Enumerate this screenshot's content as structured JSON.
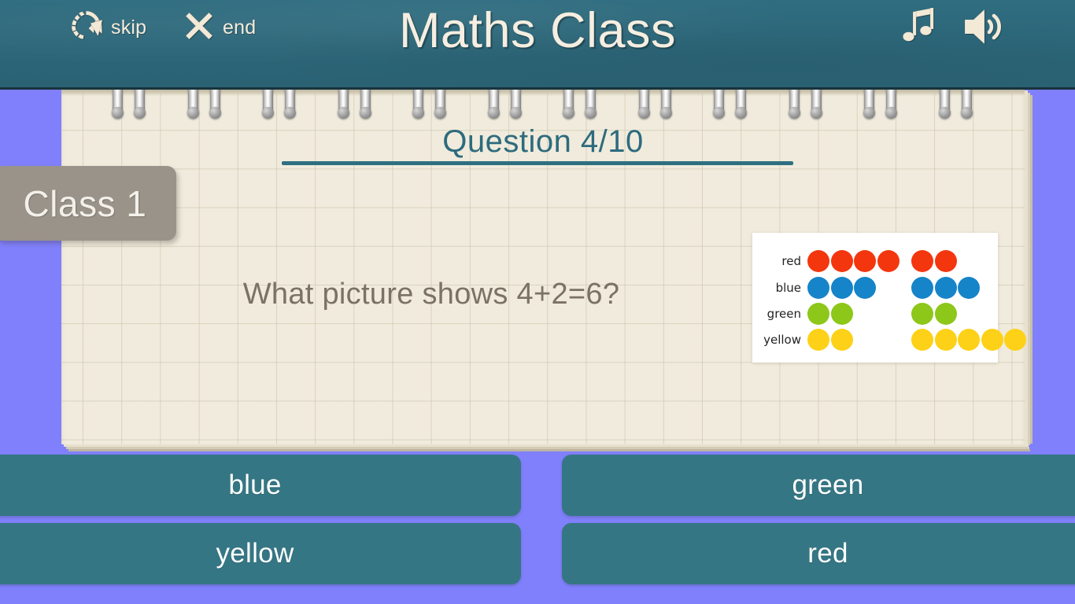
{
  "header": {
    "title": "Maths Class",
    "skip_label": "skip",
    "end_label": "end",
    "skip_icon": "skip-circular-arrow-icon",
    "end_icon": "close-x-icon",
    "music_icon": "music-note-icon",
    "sound_icon": "speaker-volume-icon",
    "background_color": "#2c6678",
    "text_color": "#f6eee0"
  },
  "class_tab": {
    "label": "Class 1",
    "background_color": "#9a938a"
  },
  "page": {
    "question_header": "Question 4/10",
    "question_number": 4,
    "question_total": 10,
    "question_text": "What picture shows 4+2=6?",
    "paper_color": "#f0ebdc",
    "accent_color": "#2d6b7e"
  },
  "chart_data": {
    "type": "table",
    "title": "",
    "xlabel": "",
    "ylabel": "",
    "legend_position": "left",
    "categories": [
      "red",
      "blue",
      "green",
      "yellow"
    ],
    "series": [
      {
        "name": "left group",
        "values": [
          4,
          3,
          2,
          2
        ]
      },
      {
        "name": "right group",
        "values": [
          2,
          3,
          2,
          5
        ]
      }
    ],
    "rows": [
      {
        "label": "red",
        "color": "#f4360e",
        "left_count": 4,
        "right_count": 2,
        "total": 6
      },
      {
        "label": "blue",
        "color": "#1684c8",
        "left_count": 3,
        "right_count": 3,
        "total": 6
      },
      {
        "label": "green",
        "color": "#8dc71a",
        "left_count": 2,
        "right_count": 2,
        "total": 4
      },
      {
        "label": "yellow",
        "color": "#fdd117",
        "left_count": 2,
        "right_count": 5,
        "total": 7
      }
    ]
  },
  "answers": {
    "options": [
      {
        "label": "blue"
      },
      {
        "label": "green"
      },
      {
        "label": "yellow"
      },
      {
        "label": "red"
      }
    ],
    "button_color": "#357684",
    "text_color": "#ffffff"
  },
  "background_color": "#8080fc"
}
